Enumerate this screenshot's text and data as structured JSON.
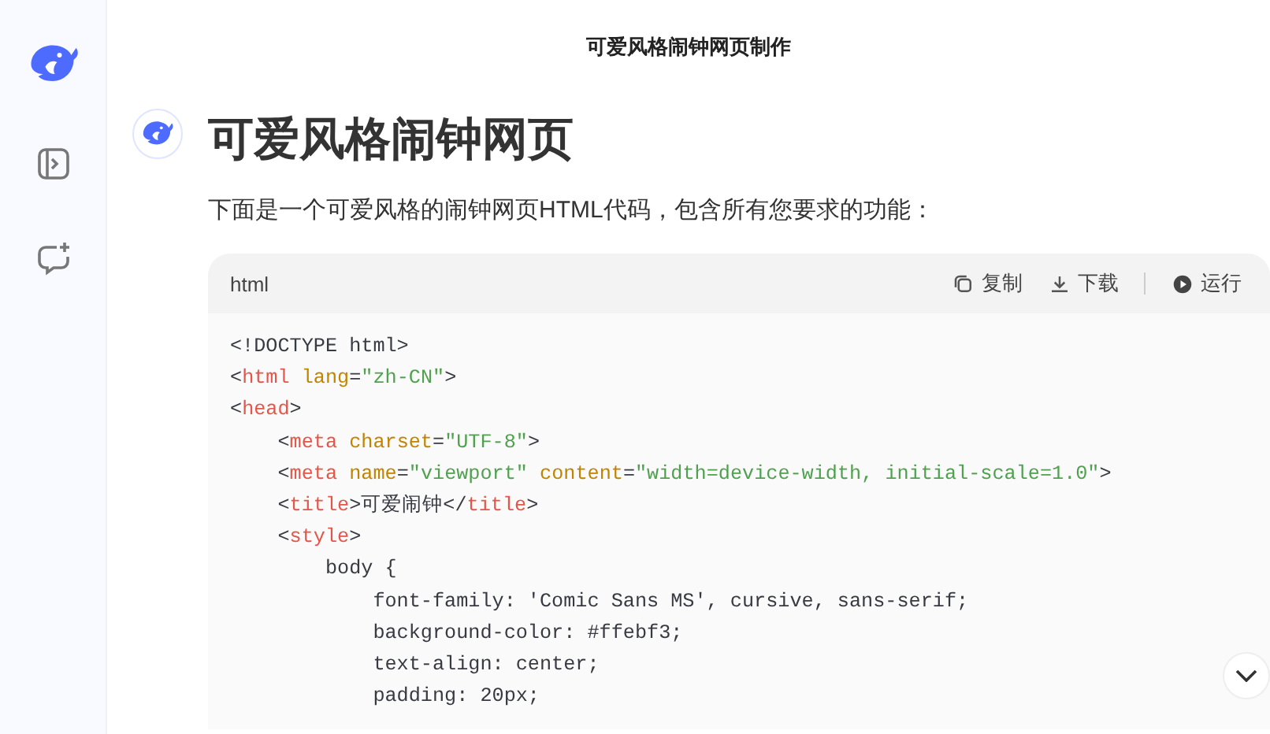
{
  "header": {
    "title": "可爱风格闹钟网页制作"
  },
  "message": {
    "heading": "可爱风格闹钟网页",
    "intro": "下面是一个可爱风格的闹钟网页HTML代码，包含所有您要求的功能：",
    "code_block": {
      "language": "html",
      "actions": [
        {
          "kind": "copy",
          "label": "复制"
        },
        {
          "kind": "download",
          "label": "下载"
        },
        {
          "kind": "run",
          "label": "运行"
        }
      ],
      "lines": [
        [
          {
            "kind": "plain",
            "text": "<!DOCTYPE html>"
          }
        ],
        [
          {
            "kind": "plain",
            "text": "<"
          },
          {
            "kind": "tag",
            "text": "html"
          },
          {
            "kind": "attr",
            "text": " lang"
          },
          {
            "kind": "plain",
            "text": "="
          },
          {
            "kind": "string",
            "text": "\"zh-CN\""
          },
          {
            "kind": "plain",
            "text": ">"
          }
        ],
        [
          {
            "kind": "plain",
            "text": "<"
          },
          {
            "kind": "tag",
            "text": "head"
          },
          {
            "kind": "plain",
            "text": ">"
          }
        ],
        [
          {
            "kind": "plain",
            "text": "    <"
          },
          {
            "kind": "tag",
            "text": "meta"
          },
          {
            "kind": "attr",
            "text": " charset"
          },
          {
            "kind": "plain",
            "text": "="
          },
          {
            "kind": "string",
            "text": "\"UTF-8\""
          },
          {
            "kind": "plain",
            "text": ">"
          }
        ],
        [
          {
            "kind": "plain",
            "text": "    <"
          },
          {
            "kind": "tag",
            "text": "meta"
          },
          {
            "kind": "attr",
            "text": " name"
          },
          {
            "kind": "plain",
            "text": "="
          },
          {
            "kind": "string",
            "text": "\"viewport\""
          },
          {
            "kind": "attr",
            "text": " content"
          },
          {
            "kind": "plain",
            "text": "="
          },
          {
            "kind": "string",
            "text": "\"width=device-width, initial-scale=1.0\""
          },
          {
            "kind": "plain",
            "text": ">"
          }
        ],
        [
          {
            "kind": "plain",
            "text": "    <"
          },
          {
            "kind": "tag",
            "text": "title"
          },
          {
            "kind": "plain",
            "text": ">可爱闹钟</"
          },
          {
            "kind": "tag",
            "text": "title"
          },
          {
            "kind": "plain",
            "text": ">"
          }
        ],
        [
          {
            "kind": "plain",
            "text": "    <"
          },
          {
            "kind": "tag",
            "text": "style"
          },
          {
            "kind": "plain",
            "text": ">"
          }
        ],
        [
          {
            "kind": "plain",
            "text": "        body {"
          }
        ],
        [
          {
            "kind": "plain",
            "text": "            font-family: 'Comic Sans MS', cursive, sans-serif;"
          }
        ],
        [
          {
            "kind": "plain",
            "text": "            background-color: #ffebf3;"
          }
        ],
        [
          {
            "kind": "plain",
            "text": "            text-align: center;"
          }
        ],
        [
          {
            "kind": "plain",
            "text": "            padding: 20px;"
          }
        ]
      ]
    }
  }
}
